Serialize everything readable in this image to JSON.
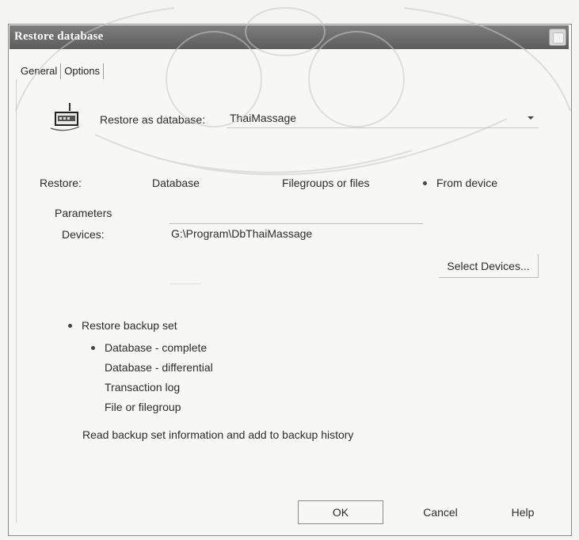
{
  "window": {
    "title": "Restore database"
  },
  "tabs": [
    {
      "label": "General",
      "active": true
    },
    {
      "label": "Options",
      "active": false
    }
  ],
  "restore_as": {
    "label": "Restore as database:",
    "value": "ThaiMassage"
  },
  "restore_mode": {
    "label": "Restore:",
    "options": [
      {
        "label": "Database",
        "selected": false
      },
      {
        "label": "Filegroups or files",
        "selected": false
      },
      {
        "label": "From device",
        "selected": true
      }
    ]
  },
  "parameters": {
    "heading": "Parameters",
    "devices_label": "Devices:",
    "devices_value": "G:\\Program\\DbThaiMassage",
    "select_devices_button": "Select Devices..."
  },
  "backup_options": {
    "restore_backup_set": "Restore backup set",
    "types": [
      {
        "label": "Database - complete",
        "selected": true
      },
      {
        "label": "Database - differential",
        "selected": false
      },
      {
        "label": "Transaction log",
        "selected": false
      },
      {
        "label": "File or filegroup",
        "selected": false
      }
    ],
    "read_info": "Read backup set information and add to backup history"
  },
  "buttons": {
    "ok": "OK",
    "cancel": "Cancel",
    "help": "Help"
  },
  "icons": {
    "database": "database-icon",
    "close": "close-icon",
    "dropdown": "chevron-down-icon"
  },
  "colors": {
    "titlebar": "#6a6a6a",
    "title_text": "#ffffff",
    "background": "#f7f7f5"
  }
}
